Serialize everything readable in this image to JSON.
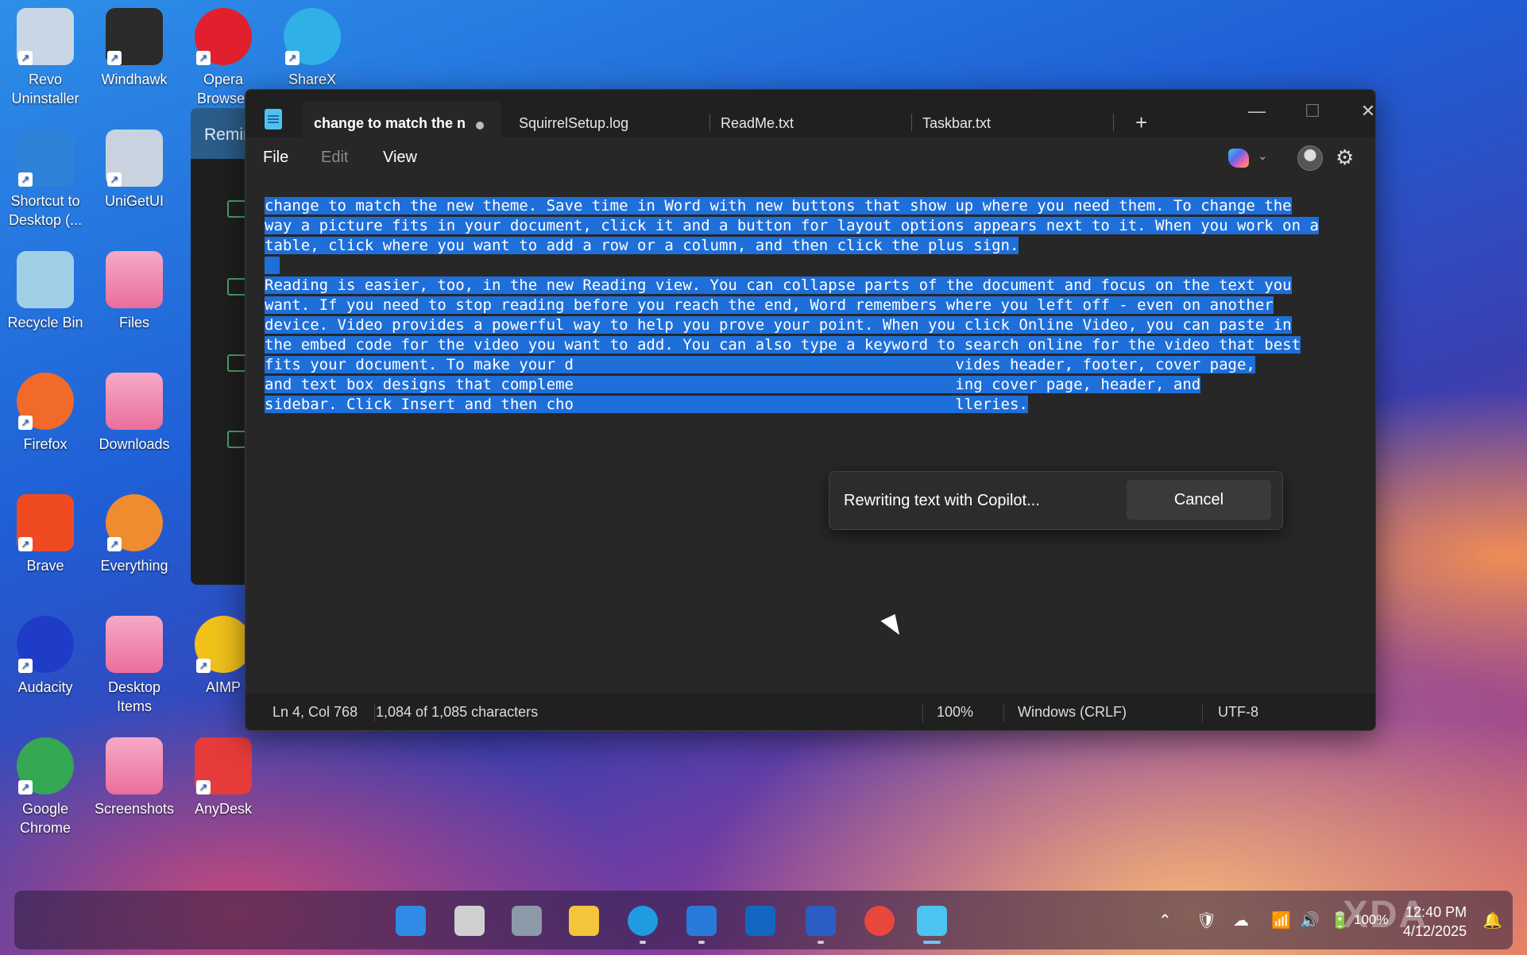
{
  "desktop_icons": [
    {
      "label": "Revo Uninstaller",
      "icon": "revo-uninstaller-icon",
      "color": "#c8d6e6"
    },
    {
      "label": "Windhawk",
      "icon": "windhawk-icon",
      "color": "#2b2b2b"
    },
    {
      "label": "Opera Browser",
      "icon": "opera-icon",
      "color": "#e21f2d"
    },
    {
      "label": "ShareX",
      "icon": "sharex-icon",
      "color": "#2fb1e8"
    },
    {
      "label": "Shortcut to Desktop (...",
      "icon": "onedrive-icon",
      "color": "#2e82d8"
    },
    {
      "label": "UniGetUI",
      "icon": "unigetui-icon",
      "color": "#c9d3e0"
    },
    {
      "label": "Recycle Bin",
      "icon": "recycle-bin-icon",
      "color": "#9fd0e8"
    },
    {
      "label": "Files",
      "icon": "folder-icon",
      "color": "#ea6e9d"
    },
    {
      "label": "Firefox",
      "icon": "firefox-icon",
      "color": "#f26a2a"
    },
    {
      "label": "Downloads",
      "icon": "folder-icon",
      "color": "#ea6e9d"
    },
    {
      "label": "Brave",
      "icon": "brave-icon",
      "color": "#f04a23"
    },
    {
      "label": "Everything",
      "icon": "everything-icon",
      "color": "#f08c30"
    },
    {
      "label": "Audacity",
      "icon": "audacity-icon",
      "color": "#1f3cc9"
    },
    {
      "label": "Desktop Items",
      "icon": "folder-icon",
      "color": "#ea6e9d"
    },
    {
      "label": "AIMP",
      "icon": "aimp-icon",
      "color": "#f2c21b"
    },
    {
      "label": "Google Chrome",
      "icon": "chrome-icon",
      "color": "#34a853"
    },
    {
      "label": "Screenshots",
      "icon": "folder-icon",
      "color": "#ea6e9d"
    },
    {
      "label": "AnyDesk",
      "icon": "anydesk-icon",
      "color": "#e63b3b"
    }
  ],
  "background_window": {
    "title": "Remin"
  },
  "notepad": {
    "tabs": [
      {
        "label": "change to match the n",
        "modified": true,
        "active": true
      },
      {
        "label": "SquirrelSetup.log",
        "active": false
      },
      {
        "label": "ReadMe.txt",
        "active": false
      },
      {
        "label": "Taskbar.txt",
        "active": false
      }
    ],
    "new_tab": "+",
    "window_controls": {
      "minimize": "—",
      "maximize": "☐",
      "close": "✕"
    },
    "menu": {
      "file": "File",
      "edit": "Edit",
      "view": "View"
    },
    "text_lines": [
      "change to match the new theme. Save time in Word with new buttons that show up where you need them. To change the",
      "way a picture fits in your document, click it and a button for layout options appears next to it. When you work on a",
      "table, click where you want to add a row or a column, and then click the plus sign.",
      "",
      "Reading is easier, too, in the new Reading view. You can collapse parts of the document and focus on the text you",
      "want. If you need to stop reading before you reach the end, Word remembers where you left off - even on another",
      "device. Video provides a powerful way to help you prove your point. When you click Online Video, you can paste in",
      "the embed code for the video you want to add. You can also type a keyword to search online for the video that best",
      "fits your document. To make your d                                          vides header, footer, cover page,",
      "and text box designs that compleme                                          ing cover page, header, and",
      "sidebar. Click Insert and then cho                                          lleries."
    ],
    "dialog": {
      "message": "Rewriting text with Copilot...",
      "cancel": "Cancel"
    },
    "status": {
      "position": "Ln 4, Col 768",
      "characters": "1,084 of 1,085 characters",
      "zoom": "100%",
      "line_ending": "Windows (CRLF)",
      "encoding": "UTF-8"
    }
  },
  "taskbar": {
    "apps": [
      {
        "name": "start-icon",
        "color": "#2f8be6"
      },
      {
        "name": "task-view-icon",
        "color": "#cfcfcf"
      },
      {
        "name": "settings-icon",
        "color": "#8c99a8"
      },
      {
        "name": "file-explorer-icon",
        "color": "#f4c43b"
      },
      {
        "name": "edge-icon",
        "color": "#1f9be0"
      },
      {
        "name": "outlook-new-icon",
        "color": "#2a7ad9"
      },
      {
        "name": "outlook-icon",
        "color": "#1466c2"
      },
      {
        "name": "word-icon",
        "color": "#2b5ec4"
      },
      {
        "name": "chrome-icon",
        "color": "#e9473b"
      },
      {
        "name": "notepad-icon",
        "color": "#4cc3f0"
      }
    ],
    "battery": "100%",
    "time": "12:40 PM",
    "date": "4/12/2025"
  }
}
